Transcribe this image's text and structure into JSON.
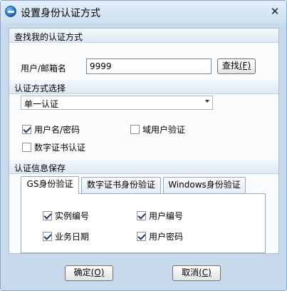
{
  "window": {
    "title": "设置身份认证方式",
    "close_glyph": "✕"
  },
  "find_section": {
    "heading": "查找我的认证方式",
    "username_label": "用户/邮箱名",
    "username_value": "9999",
    "find_button": "查找",
    "find_button_key": "(F)"
  },
  "auth_section": {
    "heading": "认证方式选择",
    "selected_option": "单一认证",
    "options": [
      {
        "label": "用户名/密码",
        "checked": true
      },
      {
        "label": "域用户验证",
        "checked": false
      },
      {
        "label": "数字证书认证",
        "checked": false
      }
    ]
  },
  "save_section": {
    "heading": "认证信息保存",
    "tabs": [
      "GS身份验证",
      "数字证书身份验证",
      "Windows身份验证"
    ],
    "active_tab": 0,
    "items": [
      {
        "label": "实例编号",
        "checked": true
      },
      {
        "label": "用户编号",
        "checked": true
      },
      {
        "label": "业务日期",
        "checked": true
      },
      {
        "label": "用户密码",
        "checked": true
      }
    ]
  },
  "footer": {
    "ok_label": "确定",
    "ok_key": "(O)",
    "cancel_label": "取消",
    "cancel_key": "(C)"
  }
}
